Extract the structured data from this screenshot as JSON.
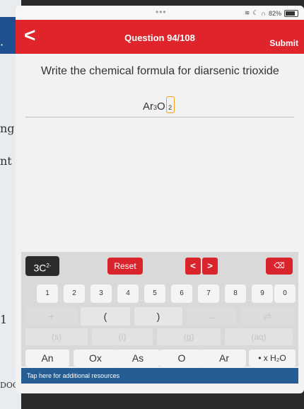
{
  "background": {
    "marks": [
      "·",
      "ng",
      "nt",
      "1",
      "DOC"
    ]
  },
  "status": {
    "battery_text": "82%"
  },
  "header": {
    "back_symbol": "<",
    "title": "Question 94/108",
    "submit_label": "Submit"
  },
  "question": {
    "text": "Write the chemical formula for diarsenic trioxide"
  },
  "answer": {
    "symbol1": "Ar",
    "sub1": "3",
    "symbol2": "O",
    "sub2": "2"
  },
  "keypad": {
    "ion_key": {
      "base": "3C",
      "charge": "2-"
    },
    "reset_label": "Reset",
    "prev_symbol": "<",
    "next_symbol": ">",
    "delete_symbol": "⌫",
    "numbers": [
      "1",
      "2",
      "3",
      "4",
      "5",
      "6",
      "7",
      "8",
      "9",
      "0"
    ],
    "symbols": [
      "+",
      "(",
      ")",
      "→",
      "⇌"
    ],
    "states": [
      "(s)",
      "(l)",
      "(g)",
      "(aq)"
    ],
    "elements": [
      "An",
      "Ox",
      "As",
      "O",
      "Ar",
      "• x H₂O"
    ]
  },
  "footer": {
    "resources_label": "Tap here for additional resources"
  },
  "colors": {
    "header_red": "#e0242c",
    "resources_blue": "#255d94",
    "answer_box_border": "#f0a020"
  }
}
